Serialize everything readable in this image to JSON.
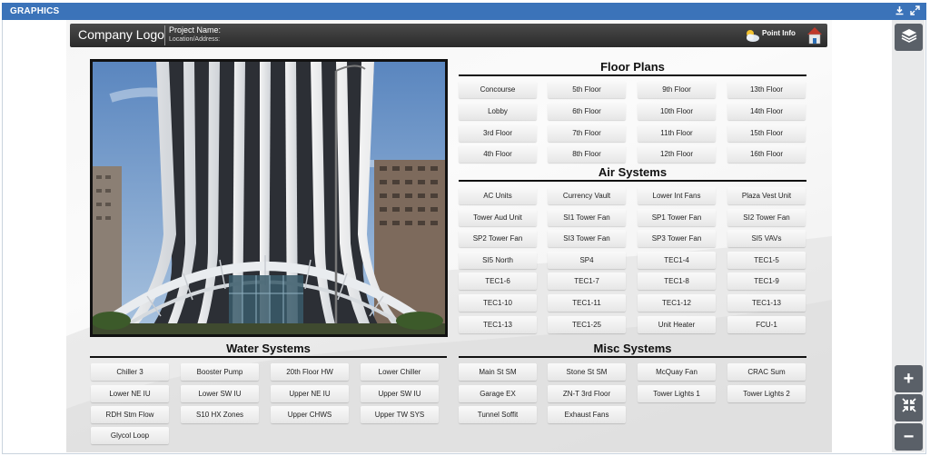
{
  "window": {
    "title": "GRAPHICS",
    "icons": [
      "download-icon",
      "expand-icon"
    ]
  },
  "header": {
    "logo": "Company Logo",
    "project_name": "Project Name:",
    "location": "Location/Address:",
    "point_info": "Point Info",
    "icons": [
      "weather-cloud-icon",
      "home-icon"
    ]
  },
  "rail": {
    "icons": [
      "layers-icon",
      "zoom-in-icon",
      "fit-screen-icon",
      "zoom-out-icon"
    ],
    "zoom_in": "+",
    "zoom_out": "−"
  },
  "floor_plans": {
    "title": "Floor Plans",
    "items": [
      "Concourse",
      "5th Floor",
      "9th Floor",
      "13th Floor",
      "Lobby",
      "6th Floor",
      "10th Floor",
      "14th Floor",
      "3rd Floor",
      "7th Floor",
      "11th Floor",
      "15th Floor",
      "4th Floor",
      "8th Floor",
      "12th Floor",
      "16th Floor"
    ]
  },
  "air_systems": {
    "title": "Air Systems",
    "items": [
      "AC Units",
      "Currency Vault",
      "Lower Int Fans",
      "Plaza Vest Unit",
      "Tower Aud Unit",
      "SI1 Tower Fan",
      "SP1 Tower Fan",
      "SI2 Tower Fan",
      "SP2 Tower Fan",
      "SI3 Tower Fan",
      "SP3 Tower Fan",
      "SI5 VAVs",
      "SI5 North",
      "SP4",
      "TEC1-4",
      "TEC1-5",
      "TEC1-6",
      "TEC1-7",
      "TEC1-8",
      "TEC1-9",
      "TEC1-10",
      "TEC1-11",
      "TEC1-12",
      "TEC1-13",
      "TEC1-13",
      "TEC1-25",
      "Unit Heater",
      "FCU-1"
    ]
  },
  "water_systems": {
    "title": "Water Systems",
    "items": [
      "Chiller 3",
      "Booster Pump",
      "20th Floor HW",
      "Lower Chiller",
      "Lower NE IU",
      "Lower SW IU",
      "Upper NE IU",
      "Upper SW IU",
      "RDH Stm Flow",
      "S10 HX Zones",
      "Upper CHWS",
      "Upper TW SYS",
      "Glycol Loop"
    ]
  },
  "misc_systems": {
    "title": "Misc Systems",
    "items": [
      "Main St SM",
      "Stone St SM",
      "McQuay Fan",
      "CRAC Sum",
      "Garage EX",
      "ZN-T 3rd Floor",
      "Tower Lights 1",
      "Tower Lights 2",
      "Tunnel Soffit",
      "Exhaust Fans"
    ]
  }
}
